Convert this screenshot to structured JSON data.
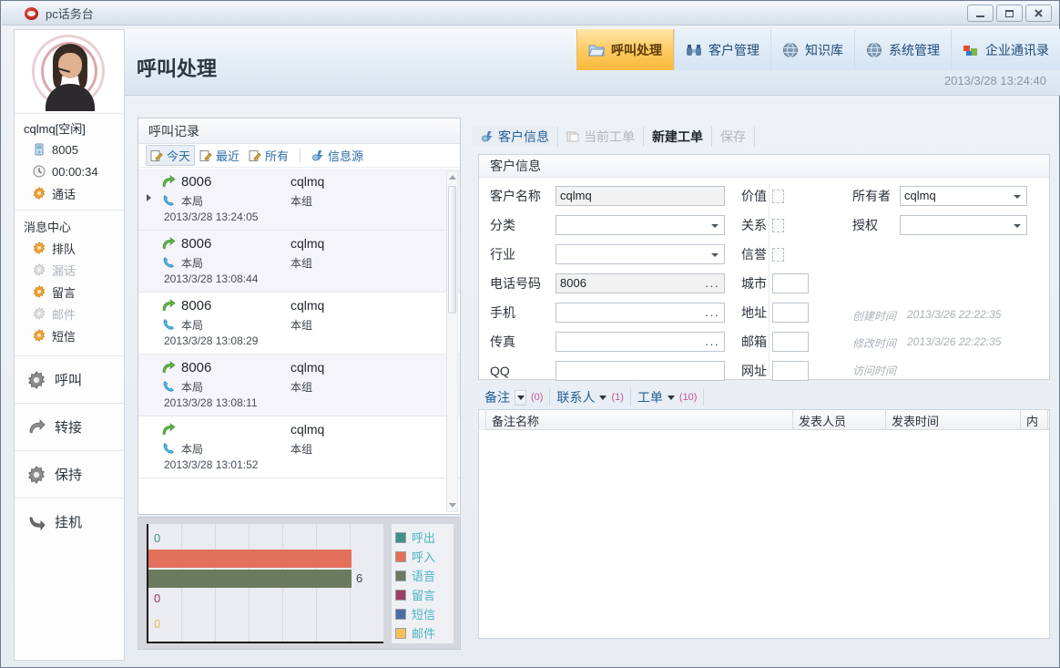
{
  "window": {
    "title": "pc话务台",
    "logo_icon": "app-logo-icon",
    "minimize_label": "—",
    "maximize_label": "❐",
    "close_label": "✕"
  },
  "header": {
    "page_title": "呼叫处理",
    "datetime": "2013/3/28 13:24:40",
    "nav_tabs": [
      {
        "label": "呼叫处理",
        "icon": "folder-icon",
        "active": true
      },
      {
        "label": "客户管理",
        "icon": "binoculars-icon",
        "active": false
      },
      {
        "label": "知识库",
        "icon": "globe-icon",
        "active": false
      },
      {
        "label": "系统管理",
        "icon": "globe-icon",
        "active": false
      },
      {
        "label": "企业通讯录",
        "icon": "blocks-icon",
        "active": false
      }
    ]
  },
  "sidebar": {
    "avatar_icon": "agent-avatar",
    "user_status": "cqlmq[空闲]",
    "status_items": [
      {
        "label": "8005",
        "icon": "phone-device-icon",
        "dim": false
      },
      {
        "label": "00:00:34",
        "icon": "clock-icon",
        "dim": false
      },
      {
        "label": "通话",
        "icon": "gear-orange-icon",
        "dim": false
      }
    ],
    "message_center_title": "消息中心",
    "message_items": [
      {
        "label": "排队",
        "icon": "gear-orange-icon",
        "dim": false
      },
      {
        "label": "漏话",
        "icon": "gear-gray-icon",
        "dim": true
      },
      {
        "label": "留言",
        "icon": "gear-orange-icon",
        "dim": false
      },
      {
        "label": "邮件",
        "icon": "gear-gray-icon",
        "dim": true
      },
      {
        "label": "短信",
        "icon": "gear-orange-icon",
        "dim": false
      }
    ],
    "action_items": [
      {
        "label": "呼叫",
        "icon": "gear-dark-icon"
      },
      {
        "label": "转接",
        "icon": "transfer-arrow-icon"
      },
      {
        "label": "保持",
        "icon": "gear-dark-icon"
      },
      {
        "label": "挂机",
        "icon": "hangup-arrow-icon"
      }
    ]
  },
  "records": {
    "panel_title": "呼叫记录",
    "toolbar": [
      {
        "label": "今天",
        "icon": "note-edit-icon",
        "selected": true
      },
      {
        "label": "最近",
        "icon": "note-edit-icon",
        "selected": false
      },
      {
        "label": "所有",
        "icon": "note-edit-icon",
        "selected": false
      },
      {
        "label": "信息源",
        "icon": "source-icon",
        "selected": false
      }
    ],
    "items": [
      {
        "number": "8006",
        "user": "cqlmq",
        "location": "本局",
        "group": "本组",
        "time": "2013/3/28 13:24:05",
        "selected": true
      },
      {
        "number": "8006",
        "user": "cqlmq",
        "location": "本局",
        "group": "本组",
        "time": "2013/3/28 13:08:44",
        "selected": false
      },
      {
        "number": "8006",
        "user": "cqlmq",
        "location": "本局",
        "group": "本组",
        "time": "2013/3/28 13:08:29",
        "selected": false
      },
      {
        "number": "8006",
        "user": "cqlmq",
        "location": "本局",
        "group": "本组",
        "time": "2013/3/28 13:08:11",
        "selected": false
      },
      {
        "number": "",
        "user": "cqlmq",
        "location": "本局",
        "group": "本组",
        "time": "2013/3/28 13:01:52",
        "selected": false
      }
    ]
  },
  "chart_data": {
    "type": "bar",
    "orientation": "horizontal",
    "title": "",
    "categories": [
      "呼出",
      "呼入",
      "语音",
      "留言",
      "短信",
      "邮件"
    ],
    "values": [
      0,
      6,
      6,
      0,
      0,
      0
    ],
    "data_labels": [
      "0",
      "",
      "6",
      "0",
      "",
      "0"
    ],
    "colors": [
      "#3f9287",
      "#e3705a",
      "#6b7a5f",
      "#9c3f63",
      "#4a6ba8",
      "#f5c056"
    ],
    "legend_position": "right",
    "grid": true,
    "xlabel": "",
    "ylabel": "",
    "xlim": [
      0,
      7
    ]
  },
  "customer": {
    "tabs": [
      {
        "label": "客户信息",
        "icon": "customer-info-icon",
        "active": true,
        "dim": false,
        "bold": false
      },
      {
        "label": "当前工单",
        "icon": "ticket-icon",
        "active": false,
        "dim": true,
        "bold": false
      },
      {
        "label": "新建工单",
        "icon": "",
        "active": false,
        "dim": false,
        "bold": true
      },
      {
        "label": "保存",
        "icon": "",
        "active": false,
        "dim": true,
        "bold": false
      }
    ],
    "groupbox_title": "客户信息",
    "fields_left": [
      {
        "label": "客户名称",
        "type": "text",
        "value": "cqlmq",
        "gray": true
      },
      {
        "label": "分类",
        "type": "select",
        "value": ""
      },
      {
        "label": "行业",
        "type": "select",
        "value": ""
      },
      {
        "label": "电话号码",
        "type": "text-dots",
        "value": "8006",
        "gray": true
      },
      {
        "label": "手机",
        "type": "text-dots",
        "value": ""
      },
      {
        "label": "传真",
        "type": "text-dots",
        "value": ""
      },
      {
        "label": "QQ",
        "type": "text",
        "value": ""
      }
    ],
    "fields_mid": [
      {
        "label": "价值",
        "type": "mini"
      },
      {
        "label": "关系",
        "type": "mini"
      },
      {
        "label": "信誉",
        "type": "mini"
      },
      {
        "label": "城市",
        "type": "small",
        "value": ""
      },
      {
        "label": "地址",
        "type": "small",
        "value": ""
      },
      {
        "label": "邮箱",
        "type": "small",
        "value": ""
      },
      {
        "label": "网址",
        "type": "small",
        "value": ""
      }
    ],
    "fields_right": [
      {
        "label": "所有者",
        "type": "select",
        "value": "cqlmq"
      },
      {
        "label": "授权",
        "type": "select",
        "value": ""
      }
    ],
    "meta": [
      {
        "label": "创建时间",
        "value": "2013/3/26 22:22:35"
      },
      {
        "label": "修改时间",
        "value": "2013/3/26 22:22:35"
      },
      {
        "label": "访问时间",
        "value": ""
      }
    ]
  },
  "bottom": {
    "tabs": [
      {
        "label": "备注",
        "count": "(0)",
        "active": true,
        "has_dropdown_button": true
      },
      {
        "label": "联系人",
        "count": "(1)",
        "active": false,
        "has_dropdown_button": false
      },
      {
        "label": "工单",
        "count": "(10)",
        "active": false,
        "has_dropdown_button": false
      }
    ],
    "table_headers": [
      "备注名称",
      "发表人员",
      "发表时间",
      "内"
    ],
    "rows": []
  }
}
